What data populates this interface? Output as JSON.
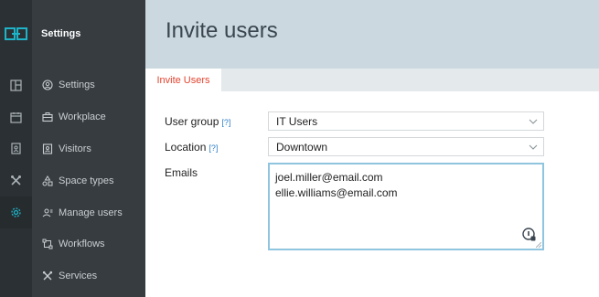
{
  "sidebar": {
    "title": "Settings",
    "items": [
      {
        "label": "Settings",
        "icon": "user-circle-icon"
      },
      {
        "label": "Workplace",
        "icon": "briefcase-icon"
      },
      {
        "label": "Visitors",
        "icon": "visitor-badge-icon"
      },
      {
        "label": "Space types",
        "icon": "shapes-icon"
      },
      {
        "label": "Manage users",
        "icon": "manage-users-icon"
      },
      {
        "label": "Workflows",
        "icon": "workflow-icon"
      },
      {
        "label": "Services",
        "icon": "tools-icon"
      }
    ]
  },
  "rail": {
    "icons": [
      "floorplan-icon",
      "calendar-icon",
      "badge-icon",
      "tools-icon",
      "gear-icon"
    ],
    "active": "gear-icon"
  },
  "page": {
    "title": "Invite users",
    "tab": "Invite Users"
  },
  "form": {
    "help_marker": "[?]",
    "user_group": {
      "label": "User group",
      "value": "IT Users"
    },
    "location": {
      "label": "Location",
      "value": "Downtown"
    },
    "emails": {
      "label": "Emails",
      "lines": [
        "joel.miller@email.com",
        "ellie.williams@email.com"
      ]
    }
  },
  "colors": {
    "rail": "#2b3034",
    "sidebar": "#363c40",
    "accent_teal": "#1fb3c7",
    "tab_text": "#e2442f",
    "header": "#cbd8df",
    "help": "#2f80c7"
  }
}
